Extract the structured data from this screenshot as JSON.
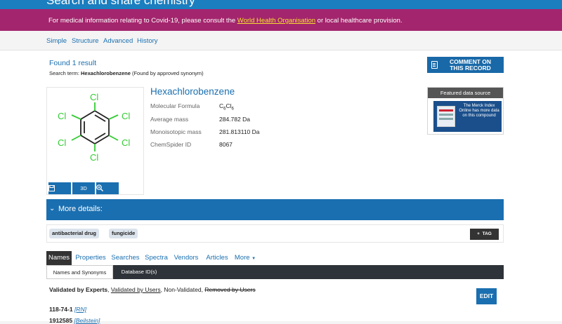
{
  "header": {
    "title": "Search and share chemistry"
  },
  "banner": {
    "text_before": "For medical information relating to Covid-19, please consult the ",
    "link": "World Health Organisation",
    "text_after": " or local healthcare provision."
  },
  "nav": {
    "items": [
      "Simple",
      "Structure",
      "Advanced",
      "History"
    ]
  },
  "search": {
    "found": "Found 1 result",
    "term_label": "Search term: ",
    "term": "Hexachlorobenzene",
    "term_note": " (Found by approved synonym)"
  },
  "comment_button": {
    "line1": "COMMENT ON",
    "line2": "THIS RECORD",
    "icon": "comment-doc-icon"
  },
  "structure": {
    "atom_labels": [
      "Cl",
      "Cl",
      "Cl",
      "Cl",
      "Cl",
      "Cl"
    ],
    "buttons": {
      "save_icon": "save-icon",
      "label_3d": "3D",
      "zoom_icon": "zoom-icon"
    }
  },
  "compound": {
    "name": "Hexachlorobenzene",
    "properties": [
      {
        "key": "Molecular Formula",
        "value": "C6Cl6"
      },
      {
        "key": "Average mass",
        "value": "284.782 Da"
      },
      {
        "key": "Monoisotopic mass",
        "value": "281.813110 Da"
      },
      {
        "key": "ChemSpider ID",
        "value": "8067"
      }
    ],
    "formula_parts": {
      "c": "C",
      "c_sub": "6",
      "cl": "Cl",
      "cl_sub": "6"
    }
  },
  "featured": {
    "header": "Featured data source",
    "ad_text": "The Merck Index Online has more data on this compound"
  },
  "more_details": {
    "label": "More details:"
  },
  "tags": {
    "items": [
      "antibacterial drug",
      "fungicide"
    ],
    "button": "TAG",
    "button_icon": "+"
  },
  "tabs": {
    "items": [
      "Names",
      "Properties",
      "Searches",
      "Spectra",
      "Vendors",
      "Articles",
      "More"
    ],
    "active": "Names"
  },
  "subtabs": {
    "items": [
      "Names and Synonyms",
      "Database ID(s)"
    ],
    "active": "Names and Synonyms"
  },
  "legend": {
    "validated": "Validated by Experts",
    "sep1": ", ",
    "users": "Validated by Users",
    "sep2": ", Non-Validated, ",
    "removed": "Removed by Users"
  },
  "edit_button": "EDIT",
  "synonyms": [
    {
      "name": "118-74-1",
      "ref": "[RN]"
    },
    {
      "name": "1912585",
      "ref": "[Beilstein]"
    }
  ],
  "colors": {
    "brand_blue": "#1a6fb0",
    "banner": "#a3256d",
    "chlorine": "#33cc33"
  }
}
